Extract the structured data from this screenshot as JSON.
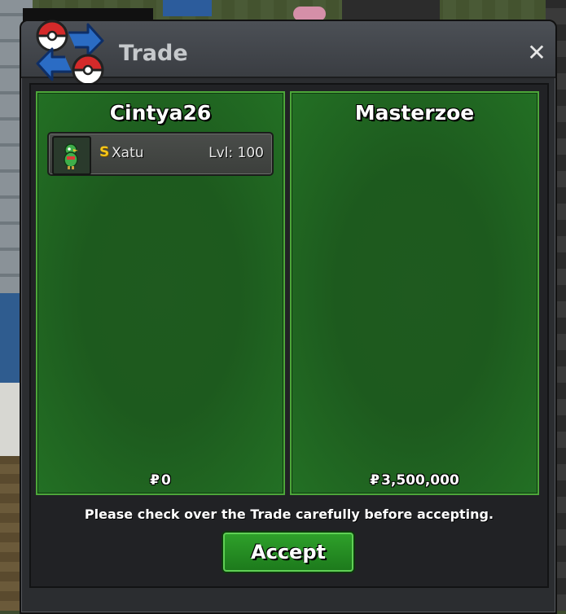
{
  "window": {
    "title": "Trade",
    "close_label": "✕"
  },
  "left_panel": {
    "player": "Cintya26",
    "money_symbol": "₽",
    "money": "0",
    "items": [
      {
        "badge": "S",
        "name": "Xatu",
        "level": "Lvl: 100",
        "icon": "xatu-sprite-icon"
      }
    ]
  },
  "right_panel": {
    "player": "Masterzoe",
    "money_symbol": "₽",
    "money": "3,500,000",
    "items": []
  },
  "notice": "Please check over the Trade carefully before accepting.",
  "accept_label": "Accept",
  "colors": {
    "panel_green": "#1d5a1e",
    "panel_border": "#4da73a",
    "shiny_badge": "#f5c518",
    "accept_button": "#2ea02a"
  }
}
